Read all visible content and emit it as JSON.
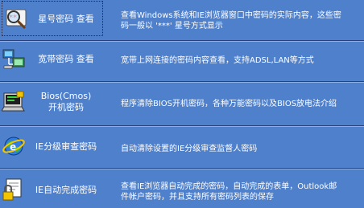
{
  "items": [
    {
      "label_line1": "星号密码 查看",
      "label_line2": "",
      "icon": "magnifier-asterisk-icon",
      "description_line1": "查看Windows系统和IE浏览器窗口中密码的实际内容，这些密",
      "description_line2": "码一般以 '***' 星号方式显示"
    },
    {
      "label_line1": "宽带密码 查看",
      "label_line2": "",
      "icon": "network-computers-icon",
      "description_line1": "宽带上网连接的密码内容查看，支持ADSL,LAN等方式",
      "description_line2": ""
    },
    {
      "label_line1": "Bios(Cmos)",
      "label_line2": "开机密码",
      "icon": "bios-chip-icon",
      "description_line1": "程序清除BIOS开机密码，各种万能密码以及BIOS放电法介绍",
      "description_line2": ""
    },
    {
      "label_line1": "IE分级审查密码",
      "label_line2": "",
      "icon": "ie-globe-icon",
      "description_line1": "自动清除设置的IE分级审查监督人密码",
      "description_line2": ""
    },
    {
      "label_line1": "IE自动完成密码",
      "label_line2": "",
      "icon": "ie-autocomplete-lock-icon",
      "description_line1": "查看IE浏览器自动完成的密码，自动完成的表单，Outlook邮",
      "description_line2": "件帐户密码，并且支持所有密码列表的保存"
    }
  ]
}
